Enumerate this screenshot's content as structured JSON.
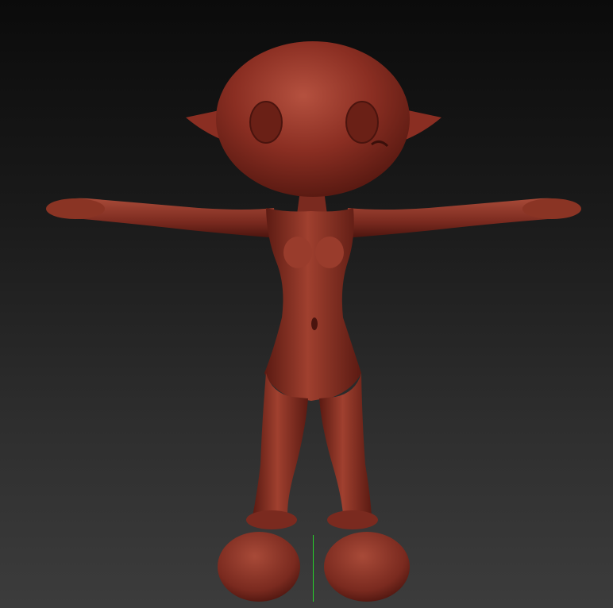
{
  "viewport": {
    "background": "gradient-dark-gray",
    "model_material": "red-wax",
    "model_color": "#8a2e22",
    "model_highlight": "#b5513f",
    "model_shadow": "#4a140e",
    "axis_color": "#27d32b",
    "axis_icon": "vertical-y-axis-line"
  }
}
